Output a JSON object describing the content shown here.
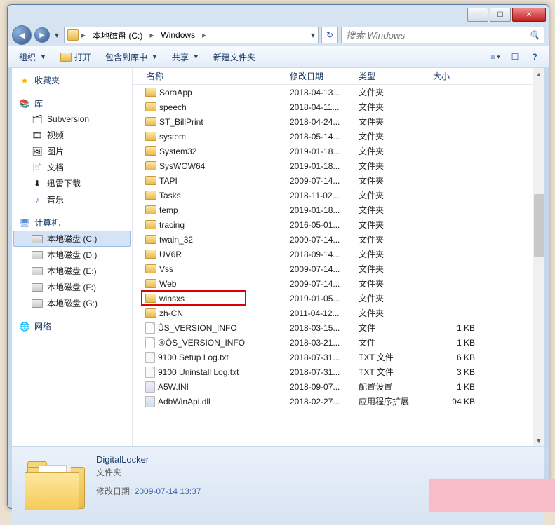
{
  "titlebar": {
    "min": "—",
    "max": "☐",
    "close": "✕"
  },
  "breadcrumb": {
    "segments": [
      "本地磁盘 (C:)",
      "Windows"
    ]
  },
  "search": {
    "placeholder": "搜索 Windows"
  },
  "toolbar": {
    "organize": "组织",
    "open": "打开",
    "include": "包含到库中",
    "share": "共享",
    "newfolder": "新建文件夹"
  },
  "columns": {
    "name": "名称",
    "date": "修改日期",
    "type": "类型",
    "size": "大小"
  },
  "sidebar": {
    "favorites": "收藏夹",
    "libraries": "库",
    "lib_items": [
      "Subversion",
      "视频",
      "图片",
      "文档",
      "迅雷下载",
      "音乐"
    ],
    "computer": "计算机",
    "drives": [
      "本地磁盘 (C:)",
      "本地磁盘 (D:)",
      "本地磁盘 (E:)",
      "本地磁盘 (F:)",
      "本地磁盘 (G:)"
    ],
    "network": "网络"
  },
  "files": [
    {
      "icon": "folder",
      "name": "SoraApp",
      "date": "2018-04-13...",
      "type": "文件夹",
      "size": ""
    },
    {
      "icon": "folder",
      "name": "speech",
      "date": "2018-04-11...",
      "type": "文件夹",
      "size": ""
    },
    {
      "icon": "folder",
      "name": "ST_BillPrint",
      "date": "2018-04-24...",
      "type": "文件夹",
      "size": ""
    },
    {
      "icon": "folder",
      "name": "system",
      "date": "2018-05-14...",
      "type": "文件夹",
      "size": ""
    },
    {
      "icon": "folder",
      "name": "System32",
      "date": "2019-01-18...",
      "type": "文件夹",
      "size": ""
    },
    {
      "icon": "folder",
      "name": "SysWOW64",
      "date": "2019-01-18...",
      "type": "文件夹",
      "size": ""
    },
    {
      "icon": "folder",
      "name": "TAPI",
      "date": "2009-07-14...",
      "type": "文件夹",
      "size": ""
    },
    {
      "icon": "folder",
      "name": "Tasks",
      "date": "2018-11-02...",
      "type": "文件夹",
      "size": ""
    },
    {
      "icon": "folder",
      "name": "temp",
      "date": "2019-01-18...",
      "type": "文件夹",
      "size": ""
    },
    {
      "icon": "folder",
      "name": "tracing",
      "date": "2016-05-01...",
      "type": "文件夹",
      "size": ""
    },
    {
      "icon": "folder",
      "name": "twain_32",
      "date": "2009-07-14...",
      "type": "文件夹",
      "size": ""
    },
    {
      "icon": "folder",
      "name": "UV6R",
      "date": "2018-09-14...",
      "type": "文件夹",
      "size": ""
    },
    {
      "icon": "folder",
      "name": "Vss",
      "date": "2009-07-14...",
      "type": "文件夹",
      "size": ""
    },
    {
      "icon": "folder",
      "name": "Web",
      "date": "2009-07-14...",
      "type": "文件夹",
      "size": ""
    },
    {
      "icon": "folder",
      "name": "winsxs",
      "date": "2019-01-05...",
      "type": "文件夹",
      "size": "",
      "highlight": true
    },
    {
      "icon": "folder",
      "name": "zh-CN",
      "date": "2011-04-12...",
      "type": "文件夹",
      "size": ""
    },
    {
      "icon": "file",
      "name": "ÛS_VERSION_INFO",
      "date": "2018-03-15...",
      "type": "文件",
      "size": "1 KB"
    },
    {
      "icon": "file",
      "name": "④ÓS_VERSION_INFO",
      "date": "2018-03-21...",
      "type": "文件",
      "size": "1 KB"
    },
    {
      "icon": "txt",
      "name": "9100 Setup Log.txt",
      "date": "2018-07-31...",
      "type": "TXT 文件",
      "size": "6 KB"
    },
    {
      "icon": "txt",
      "name": "9100 Uninstall Log.txt",
      "date": "2018-07-31...",
      "type": "TXT 文件",
      "size": "3 KB"
    },
    {
      "icon": "ini",
      "name": "A5W.INI",
      "date": "2018-09-07...",
      "type": "配置设置",
      "size": "1 KB"
    },
    {
      "icon": "dll",
      "name": "AdbWinApi.dll",
      "date": "2018-02-27...",
      "type": "应用程序扩展",
      "size": "94 KB"
    }
  ],
  "details": {
    "name": "DigitalLocker",
    "type": "文件夹",
    "mod_label": "修改日期:",
    "mod_value": "2009-07-14 13:37"
  }
}
